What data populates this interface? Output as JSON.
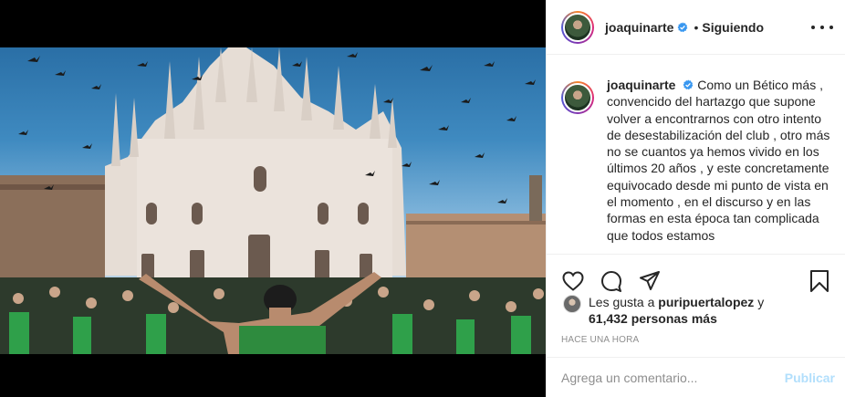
{
  "post": {
    "username": "joaquinarte",
    "follow_status": "Siguiendo",
    "separator": "•",
    "caption_username": "joaquinarte",
    "caption_text": "Como un Bético más , convencido del hartazgo que supone volver a encontrarnos con otro intento de desestabilización del club , otro más no se cuantos ya hemos vivido en los últimos 20 años , y este concretamente equivocado desde mi punto de vista en el momento , en el discurso y en las formas en esta época tan complicada que todos estamos",
    "likes_prefix": "Les gusta a",
    "likes_user": "puripuertalopez",
    "likes_and": "y",
    "likes_count_text": "61,432 personas más",
    "time_ago": "HACE UNA HORA",
    "comment_placeholder": "Agrega un comentario...",
    "publish_label": "Publicar"
  },
  "icons": {
    "verified": "verified-badge-icon",
    "more": "more-options-icon",
    "like": "heart-icon",
    "comment": "comment-bubble-icon",
    "share": "paper-plane-icon",
    "save": "bookmark-icon"
  },
  "colors": {
    "verified": "#3897f0",
    "publish_disabled": "#b2dffc",
    "muted": "#8e8e8e",
    "text": "#262626"
  }
}
